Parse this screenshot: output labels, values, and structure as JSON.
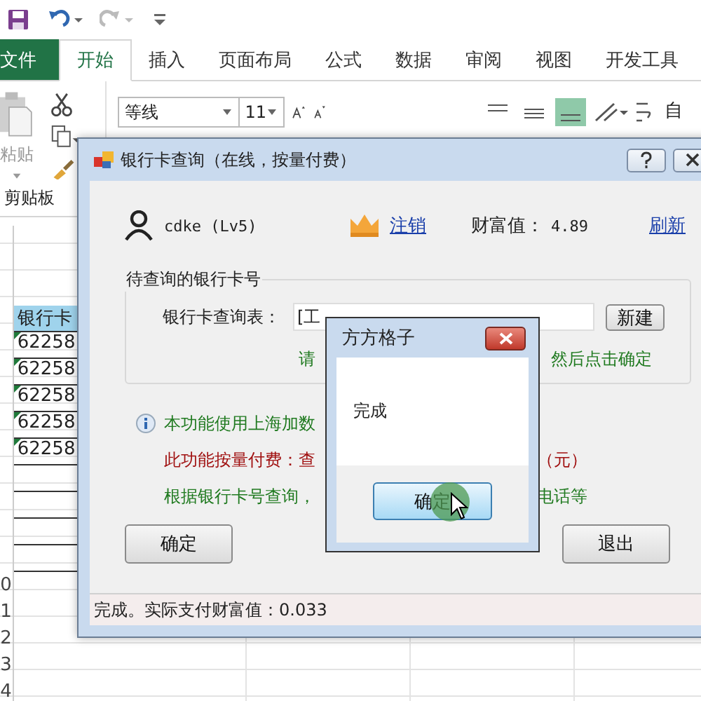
{
  "ribbon": {
    "tabs": [
      {
        "label": "文件",
        "kind": "file",
        "selected": false
      },
      {
        "label": "开始",
        "kind": "tab",
        "selected": true
      },
      {
        "label": "插入",
        "kind": "tab",
        "selected": false
      },
      {
        "label": "页面布局",
        "kind": "tab",
        "selected": false
      },
      {
        "label": "公式",
        "kind": "tab",
        "selected": false
      },
      {
        "label": "数据",
        "kind": "tab",
        "selected": false
      },
      {
        "label": "审阅",
        "kind": "tab",
        "selected": false
      },
      {
        "label": "视图",
        "kind": "tab",
        "selected": false
      },
      {
        "label": "开发工具",
        "kind": "tab",
        "selected": false
      }
    ],
    "paste_label": "粘贴",
    "clipboard_label": "剪贴板",
    "font_name": "等线",
    "font_size": "11",
    "wrap_label": "自"
  },
  "sheet": {
    "header": "银行卡",
    "cells": [
      "62258",
      "62258",
      "62258",
      "62258",
      "62258"
    ],
    "row_numbers": [
      "0",
      "1",
      "2",
      "3",
      "4"
    ]
  },
  "main_dialog": {
    "title": "银行卡查询（在线，按量付费）",
    "user": "cdke (Lv5)",
    "logout": "注销",
    "wealth_label": "财富值：",
    "wealth": "4.89",
    "refresh": "刷新",
    "group_title": "待查询的银行卡号",
    "table_label": "银行卡查询表：",
    "table_value": "[工",
    "new_button": "新建",
    "hint_parts": [
      "请",
      "然后点击确定"
    ],
    "info": "本功能使用上海加数",
    "pricing_parts": [
      "此功能按量付费：查",
      "（元）"
    ],
    "desc_parts": [
      "根据银行卡号查询，",
      "电话等"
    ],
    "ok": "确定",
    "exit": "退出",
    "status": "完成。实际支付财富值：0.033"
  },
  "message_box": {
    "title": "方方格子",
    "message": "完成",
    "ok": "确定"
  }
}
